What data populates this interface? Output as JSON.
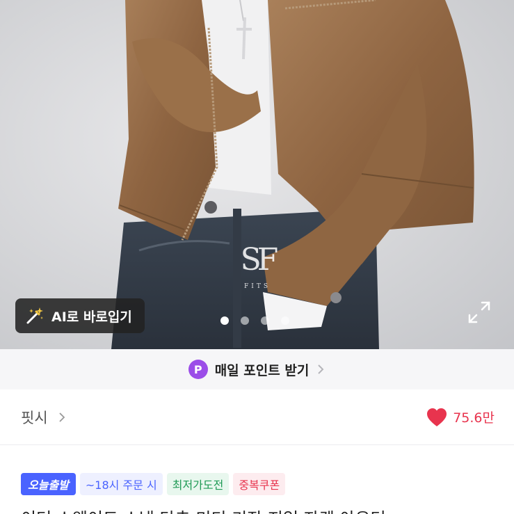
{
  "hero": {
    "brand_monogram": "SF",
    "brand_wordmark": "FITS",
    "ai_button_label": "AI로 바로입기",
    "carousel": {
      "total": 4,
      "active_index": 0
    }
  },
  "points_banner": {
    "badge": "P",
    "label": "매일 포인트 받기"
  },
  "brand": {
    "name": "핏시",
    "likes": "75.6만"
  },
  "badges": {
    "today_ship": "오늘출발",
    "cutoff": "~18시 주문 시",
    "lowest": "최저가도전",
    "coupon": "중복쿠폰"
  },
  "product": {
    "title": "이터 스웨이드 스냅 단추 미디 기장 지업 자켓 아우터"
  },
  "colors": {
    "accent_purple": "#9b4de8",
    "heart_red": "#e8344e",
    "today_blue": "#4a63ff"
  }
}
